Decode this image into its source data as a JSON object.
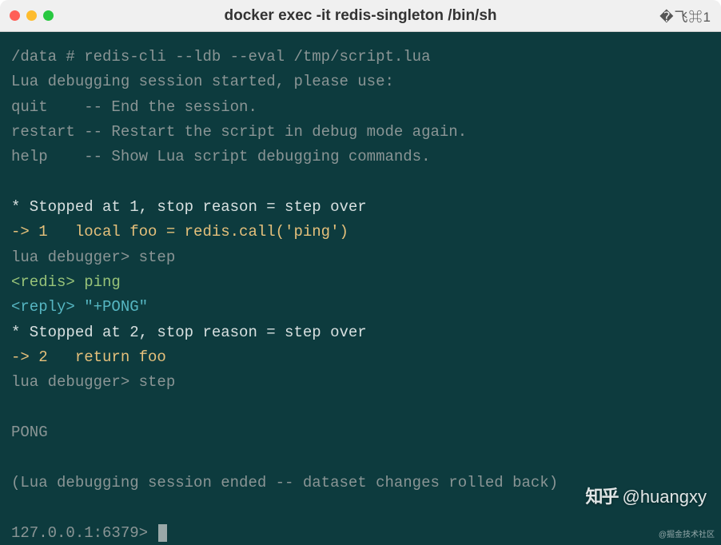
{
  "window": {
    "title": "docker exec -it redis-singleton /bin/sh",
    "shortcut": "�飞⌘1"
  },
  "terminal": {
    "lines": [
      {
        "segments": [
          {
            "cls": "gray",
            "text": "/data # redis-cli --ldb --eval /tmp/script.lua"
          }
        ]
      },
      {
        "segments": [
          {
            "cls": "gray",
            "text": "Lua debugging session started, please use:"
          }
        ]
      },
      {
        "segments": [
          {
            "cls": "gray",
            "text": "quit    -- End the session."
          }
        ]
      },
      {
        "segments": [
          {
            "cls": "gray",
            "text": "restart -- Restart the script in debug mode again."
          }
        ]
      },
      {
        "segments": [
          {
            "cls": "gray",
            "text": "help    -- Show Lua script debugging commands."
          }
        ]
      },
      {
        "segments": [
          {
            "cls": "",
            "text": " "
          }
        ]
      },
      {
        "segments": [
          {
            "cls": "white",
            "text": "* Stopped at 1, stop reason = step over"
          }
        ]
      },
      {
        "segments": [
          {
            "cls": "yellow",
            "text": "-> 1   local foo = redis.call('ping')"
          }
        ]
      },
      {
        "segments": [
          {
            "cls": "gray",
            "text": "lua debugger> step"
          }
        ]
      },
      {
        "segments": [
          {
            "cls": "green",
            "text": "<redis> ping"
          }
        ]
      },
      {
        "segments": [
          {
            "cls": "cyan",
            "text": "<reply> \"+PONG\""
          }
        ]
      },
      {
        "segments": [
          {
            "cls": "white",
            "text": "* Stopped at 2, stop reason = step over"
          }
        ]
      },
      {
        "segments": [
          {
            "cls": "yellow",
            "text": "-> 2   return foo"
          }
        ]
      },
      {
        "segments": [
          {
            "cls": "gray",
            "text": "lua debugger> step"
          }
        ]
      },
      {
        "segments": [
          {
            "cls": "",
            "text": " "
          }
        ]
      },
      {
        "segments": [
          {
            "cls": "gray",
            "text": "PONG"
          }
        ]
      },
      {
        "segments": [
          {
            "cls": "",
            "text": " "
          }
        ]
      },
      {
        "segments": [
          {
            "cls": "gray",
            "text": "(Lua debugging session ended -- dataset changes rolled back)"
          }
        ]
      },
      {
        "segments": [
          {
            "cls": "",
            "text": " "
          }
        ]
      },
      {
        "segments": [
          {
            "cls": "gray",
            "text": "127.0.0.1:6379> "
          }
        ],
        "cursor": true
      }
    ]
  },
  "watermark": {
    "logo": "知乎",
    "handle": "@huangxy",
    "small": "@掘金技术社区"
  }
}
